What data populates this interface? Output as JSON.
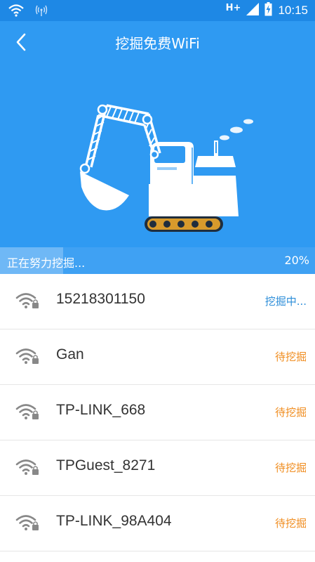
{
  "status_bar": {
    "network": "H+",
    "time": "10:15"
  },
  "header": {
    "title": "挖掘免费WiFi",
    "back_icon": "chevron-left-icon"
  },
  "progress": {
    "label": "正在努力挖掘...",
    "percent_text": "20%",
    "value": 0.2
  },
  "networks": [
    {
      "ssid": "15218301150",
      "status": "挖掘中...",
      "status_color": "#2d8ed9"
    },
    {
      "ssid": "Gan",
      "status": "待挖掘",
      "status_color": "#f08c1e"
    },
    {
      "ssid": "TP-LINK_668",
      "status": "待挖掘",
      "status_color": "#f08c1e"
    },
    {
      "ssid": "TPGuest_8271",
      "status": "待挖掘",
      "status_color": "#f08c1e"
    },
    {
      "ssid": "TP-LINK_98A404",
      "status": "待挖掘",
      "status_color": "#f08c1e"
    }
  ],
  "colors": {
    "status_bar": "#1e88e5",
    "header": "#2f9af2",
    "digging": "#2d8ed9",
    "pending": "#f08c1e"
  }
}
